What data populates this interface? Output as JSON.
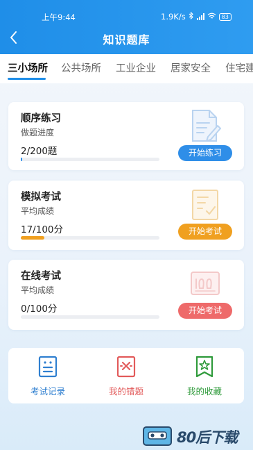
{
  "status_bar": {
    "time": "上午9:44",
    "speed": "1.9K/s",
    "battery": "83"
  },
  "nav": {
    "title": "知识题库"
  },
  "tabs": [
    {
      "label": "三小场所",
      "active": true
    },
    {
      "label": "公共场所",
      "active": false
    },
    {
      "label": "工业企业",
      "active": false
    },
    {
      "label": "居家安全",
      "active": false
    },
    {
      "label": "住宅建",
      "active": false
    }
  ],
  "cards": [
    {
      "title": "顺序练习",
      "subtitle": "做题进度",
      "value": "2/200题",
      "progress": 0.01,
      "button": "开始练习",
      "accent": "#2f8ee8",
      "icon": "document-edit-icon"
    },
    {
      "title": "模拟考试",
      "subtitle": "平均成绩",
      "value": "17/100分",
      "progress": 0.17,
      "button": "开始考试",
      "accent": "#f0a020",
      "icon": "exam-paper-check-icon"
    },
    {
      "title": "在线考试",
      "subtitle": "平均成绩",
      "value": "0/100分",
      "progress": 0.0,
      "button": "开始考试",
      "accent": "#ee6a6a",
      "icon": "score-100-icon"
    }
  ],
  "bottom": [
    {
      "label": "考试记录",
      "color": "#2f7fd0",
      "icon": "exam-record-icon"
    },
    {
      "label": "我的错题",
      "color": "#e25a5a",
      "icon": "wrong-question-icon"
    },
    {
      "label": "我的收藏",
      "color": "#2e9a3a",
      "icon": "favorite-bookmark-icon"
    }
  ],
  "watermark": {
    "text": "80后下载"
  }
}
